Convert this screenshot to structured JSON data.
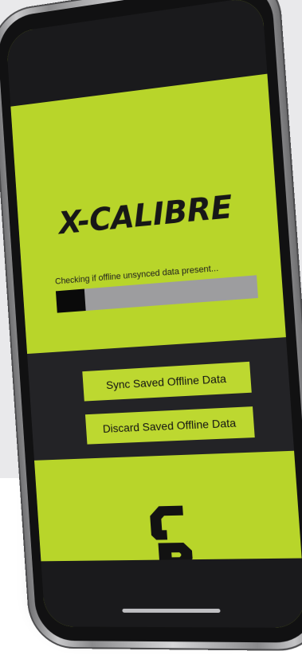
{
  "app": {
    "logo_text": "X-CALIBRE",
    "brand_mark": "CR"
  },
  "sync": {
    "status_text": "Checking if offline unsynced data present...",
    "progress_fraction": 0.15
  },
  "actions": {
    "sync_label": "Sync Saved Offline Data",
    "discard_label": "Discard Saved Offline Data"
  },
  "colors": {
    "accent": "#b8d52a",
    "dark_band": "#232326",
    "progress_track": "#9d9d9f",
    "progress_fill": "#0a0a0a"
  },
  "icons": [
    "cr-brand-icon"
  ]
}
